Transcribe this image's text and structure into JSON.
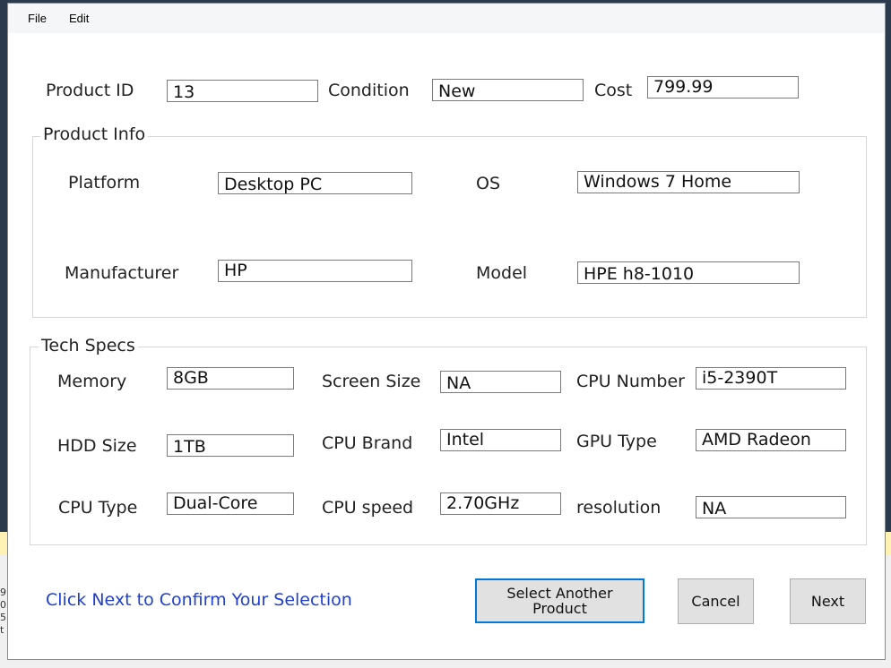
{
  "menu": {
    "file": "File",
    "edit": "Edit"
  },
  "header": {
    "product_id_label": "Product ID",
    "product_id_value": "13",
    "condition_label": "Condition",
    "condition_value": "New",
    "cost_label": "Cost",
    "cost_value": "799.99"
  },
  "product_info": {
    "title": "Product Info",
    "platform_label": "Platform",
    "platform_value": "Desktop PC",
    "os_label": "OS",
    "os_value": "Windows 7 Home",
    "manufacturer_label": "Manufacturer",
    "manufacturer_value": "HP",
    "model_label": "Model",
    "model_value": "HPE h8-1010"
  },
  "tech_specs": {
    "title": "Tech Specs",
    "memory_label": "Memory",
    "memory_value": "8GB",
    "screen_size_label": "Screen Size",
    "screen_size_value": "NA",
    "cpu_number_label": "CPU Number",
    "cpu_number_value": "i5-2390T",
    "hdd_size_label": "HDD Size",
    "hdd_size_value": "1TB",
    "cpu_brand_label": "CPU Brand",
    "cpu_brand_value": "Intel",
    "gpu_type_label": "GPU Type",
    "gpu_type_value": "AMD Radeon",
    "cpu_type_label": "CPU Type",
    "cpu_type_value": "Dual-Core",
    "cpu_speed_label": "CPU speed",
    "cpu_speed_value": "2.70GHz",
    "resolution_label": "resolution",
    "resolution_value": "NA"
  },
  "footer": {
    "confirm_text": "Click Next to Confirm Your Selection",
    "select_another_label": "Select Another Product",
    "cancel_label": "Cancel",
    "next_label": "Next"
  },
  "background": {
    "peek_lines": [
      "9",
      "0",
      "5",
      "t"
    ]
  },
  "colors": {
    "link": "#1f3fd0",
    "focus_border": "#0078d7",
    "desktop_bg": "#2b3a4d",
    "background_highlight": "#fff2b3"
  }
}
